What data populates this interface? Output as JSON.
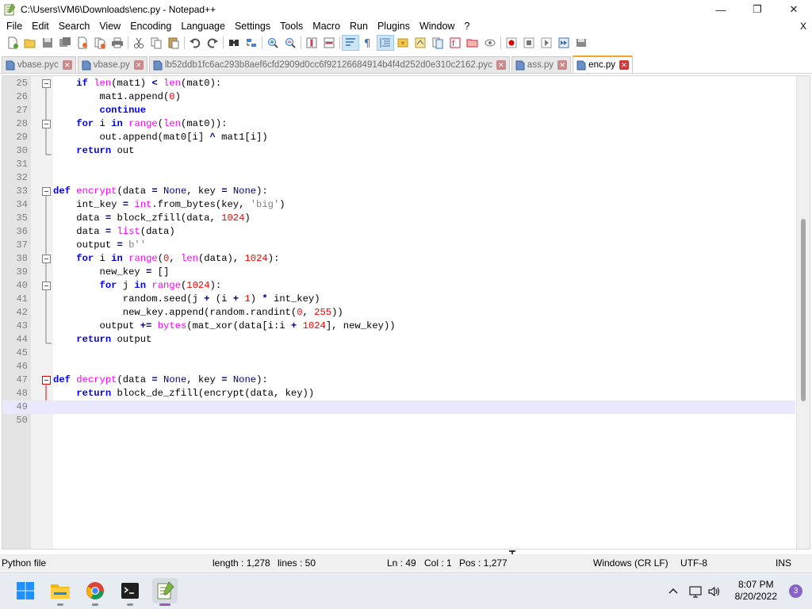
{
  "window": {
    "title": "C:\\Users\\VM6\\Downloads\\enc.py - Notepad++",
    "minimize": "—",
    "maximize": "❐",
    "close": "✕"
  },
  "menu": {
    "items": [
      "File",
      "Edit",
      "Search",
      "View",
      "Encoding",
      "Language",
      "Settings",
      "Tools",
      "Macro",
      "Run",
      "Plugins",
      "Window",
      "?"
    ],
    "close": "X"
  },
  "tabs": [
    {
      "label": "vbase.pyc",
      "active": false
    },
    {
      "label": "vbase.py",
      "active": false
    },
    {
      "label": "lb52ddb1fc6ac293b8aef6cfd2909d0cc6f92126684914b4f4d252d0e310c2162.pyc",
      "active": false
    },
    {
      "label": "ass.py",
      "active": false
    },
    {
      "label": "enc.py",
      "active": true
    }
  ],
  "editor": {
    "current_line": 49,
    "lines": [
      {
        "n": "25",
        "html": "    <span class='kw'>if</span> <span class='fn'>len</span>(mat1) <span class='op'>&lt;</span> <span class='fn'>len</span>(mat0):"
      },
      {
        "n": "26",
        "html": "        mat1.append(<span class='num'>0</span>)"
      },
      {
        "n": "27",
        "html": "        <span class='kw'>continue</span>"
      },
      {
        "n": "28",
        "html": "    <span class='kw'>for</span> i <span class='kw'>in</span> <span class='fn'>range</span>(<span class='fn'>len</span>(mat0)):"
      },
      {
        "n": "29",
        "html": "        out.append(mat0[i] <span class='op'>^</span> mat1[i])"
      },
      {
        "n": "30",
        "html": "    <span class='kw'>return</span> out"
      },
      {
        "n": "31",
        "html": ""
      },
      {
        "n": "32",
        "html": ""
      },
      {
        "n": "33",
        "html": "<span class='df'>def</span> <span class='fname'>encrypt</span>(data <span class='op'>=</span> <span class='none-kw'>None</span>, key <span class='op'>=</span> <span class='none-kw'>None</span>):"
      },
      {
        "n": "34",
        "html": "    int_key <span class='op'>=</span> <span class='fn'>int</span>.from_bytes(key, <span class='str'>'big'</span>)"
      },
      {
        "n": "35",
        "html": "    data <span class='op'>=</span> block_zfill(data, <span class='num'>1024</span>)"
      },
      {
        "n": "36",
        "html": "    data <span class='op'>=</span> <span class='fn'>list</span>(data)"
      },
      {
        "n": "37",
        "html": "    output <span class='op'>=</span> <span class='str'>b''</span>"
      },
      {
        "n": "38",
        "html": "    <span class='kw'>for</span> i <span class='kw'>in</span> <span class='fn'>range</span>(<span class='num'>0</span>, <span class='fn'>len</span>(data), <span class='num'>1024</span>):"
      },
      {
        "n": "39",
        "html": "        new_key <span class='op'>=</span> []"
      },
      {
        "n": "40",
        "html": "        <span class='kw'>for</span> j <span class='kw'>in</span> <span class='fn'>range</span>(<span class='num'>1024</span>):"
      },
      {
        "n": "41",
        "html": "            random.seed(j <span class='op'>+</span> (i <span class='op'>+</span> <span class='num'>1</span>) <span class='op'>*</span> int_key)"
      },
      {
        "n": "42",
        "html": "            new_key.append(random.randint(<span class='num'>0</span>, <span class='num'>255</span>))"
      },
      {
        "n": "43",
        "html": "        output <span class='op'>+=</span> <span class='fn'>bytes</span>(mat_xor(data[i:i <span class='op'>+</span> <span class='num'>1024</span>], new_key))"
      },
      {
        "n": "44",
        "html": "    <span class='kw'>return</span> output"
      },
      {
        "n": "45",
        "html": ""
      },
      {
        "n": "46",
        "html": ""
      },
      {
        "n": "47",
        "html": "<span class='df'>def</span> <span class='fname'>decrypt</span>(data <span class='op'>=</span> <span class='none-kw'>None</span>, key <span class='op'>=</span> <span class='none-kw'>None</span>):"
      },
      {
        "n": "48",
        "html": "    <span class='kw'>return</span> block_de_zfill(encrypt(data, key))"
      },
      {
        "n": "49",
        "html": ""
      },
      {
        "n": "50",
        "html": ""
      }
    ]
  },
  "status": {
    "language": "Python file",
    "length": "length : 1,278",
    "lines": "lines : 50",
    "ln": "Ln : 49",
    "col": "Col : 1",
    "pos": "Pos : 1,277",
    "eol": "Windows (CR LF)",
    "encoding": "UTF-8",
    "mode": "INS"
  },
  "taskbar": {
    "time": "8:07 PM",
    "date": "8/20/2022",
    "notifications": "3"
  },
  "colors": {
    "keyword": "#0000ff",
    "builtin": "#ff00ff",
    "number": "#ff0000",
    "active_tab_accent": "#f5a623",
    "current_line_bg": "#e8e8ff"
  }
}
